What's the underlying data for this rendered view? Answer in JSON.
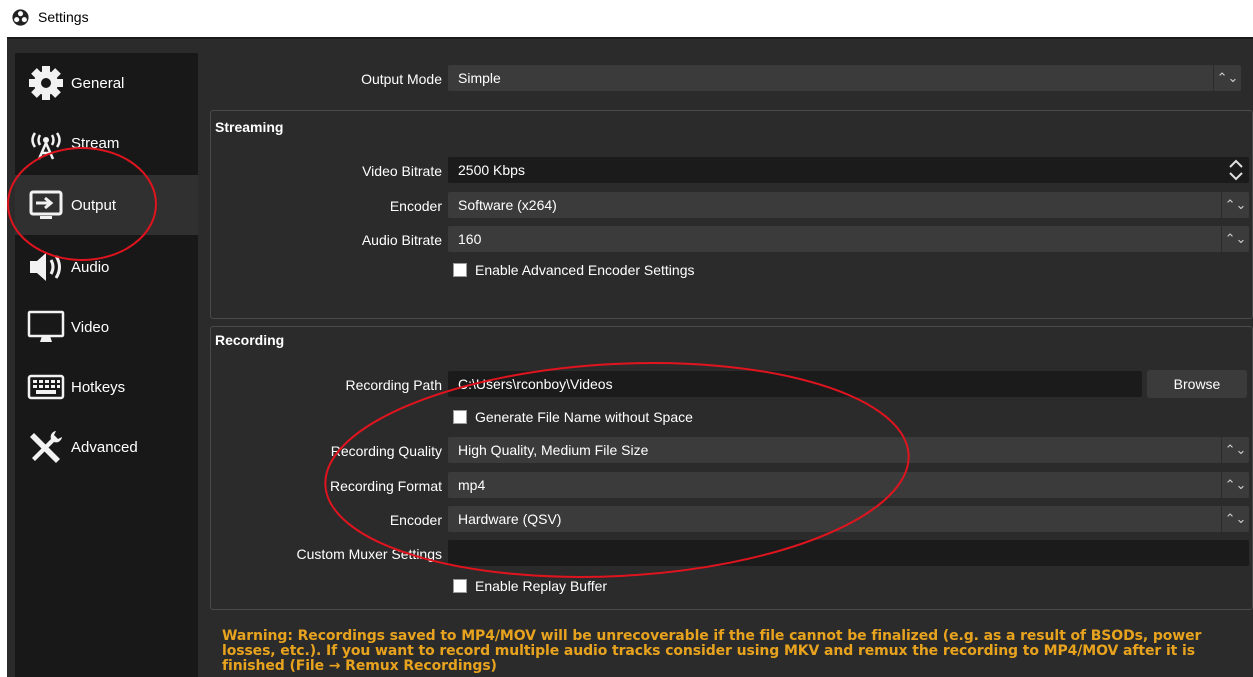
{
  "window": {
    "title": "Settings"
  },
  "sidebar": {
    "items": [
      {
        "label": "General"
      },
      {
        "label": "Stream"
      },
      {
        "label": "Output"
      },
      {
        "label": "Audio"
      },
      {
        "label": "Video"
      },
      {
        "label": "Hotkeys"
      },
      {
        "label": "Advanced"
      }
    ],
    "active": "Output"
  },
  "output_mode": {
    "label": "Output Mode",
    "value": "Simple"
  },
  "streaming": {
    "title": "Streaming",
    "video_bitrate": {
      "label": "Video Bitrate",
      "value": "2500 Kbps"
    },
    "encoder": {
      "label": "Encoder",
      "value": "Software (x264)"
    },
    "audio_bitrate": {
      "label": "Audio Bitrate",
      "value": "160"
    },
    "advanced_encoder": {
      "label": "Enable Advanced Encoder Settings",
      "checked": false
    }
  },
  "recording": {
    "title": "Recording",
    "path": {
      "label": "Recording Path",
      "value": "C:\\Users\\rconboy\\Videos",
      "browse_label": "Browse"
    },
    "filename_no_space": {
      "label": "Generate File Name without Space",
      "checked": false
    },
    "quality": {
      "label": "Recording Quality",
      "value": "High Quality, Medium File Size"
    },
    "format": {
      "label": "Recording Format",
      "value": "mp4"
    },
    "encoder": {
      "label": "Encoder",
      "value": "Hardware (QSV)"
    },
    "muxer": {
      "label": "Custom Muxer Settings",
      "value": ""
    },
    "replay_buffer": {
      "label": "Enable Replay Buffer",
      "checked": false
    }
  },
  "warning": {
    "text": "Warning: Recordings saved to MP4/MOV will be unrecoverable if the file cannot be finalized (e.g. as a result of BSODs, power losses, etc.). If you want to record multiple audio tracks consider using MKV and remux the recording to MP4/MOV after it is finished (File → Remux Recordings)"
  },
  "icons": {
    "app": "obs-logo-icon",
    "general": "gear-icon",
    "stream": "broadcast-antenna-icon",
    "output": "output-monitor-icon",
    "audio": "speaker-icon",
    "video": "monitor-icon",
    "hotkeys": "keyboard-icon",
    "advanced": "tools-icon",
    "dropdown": "chevron-updown-icon",
    "spinner": "spin-arrows-icon"
  },
  "colors": {
    "window_bg": "#2b2b2b",
    "sidebar_bg": "#181818",
    "active_item_bg": "#303030",
    "field_bg": "#3b3b3b",
    "input_bg": "#1b1b1b",
    "warning_text": "#e8a31e",
    "annotation": "#e0141e"
  }
}
